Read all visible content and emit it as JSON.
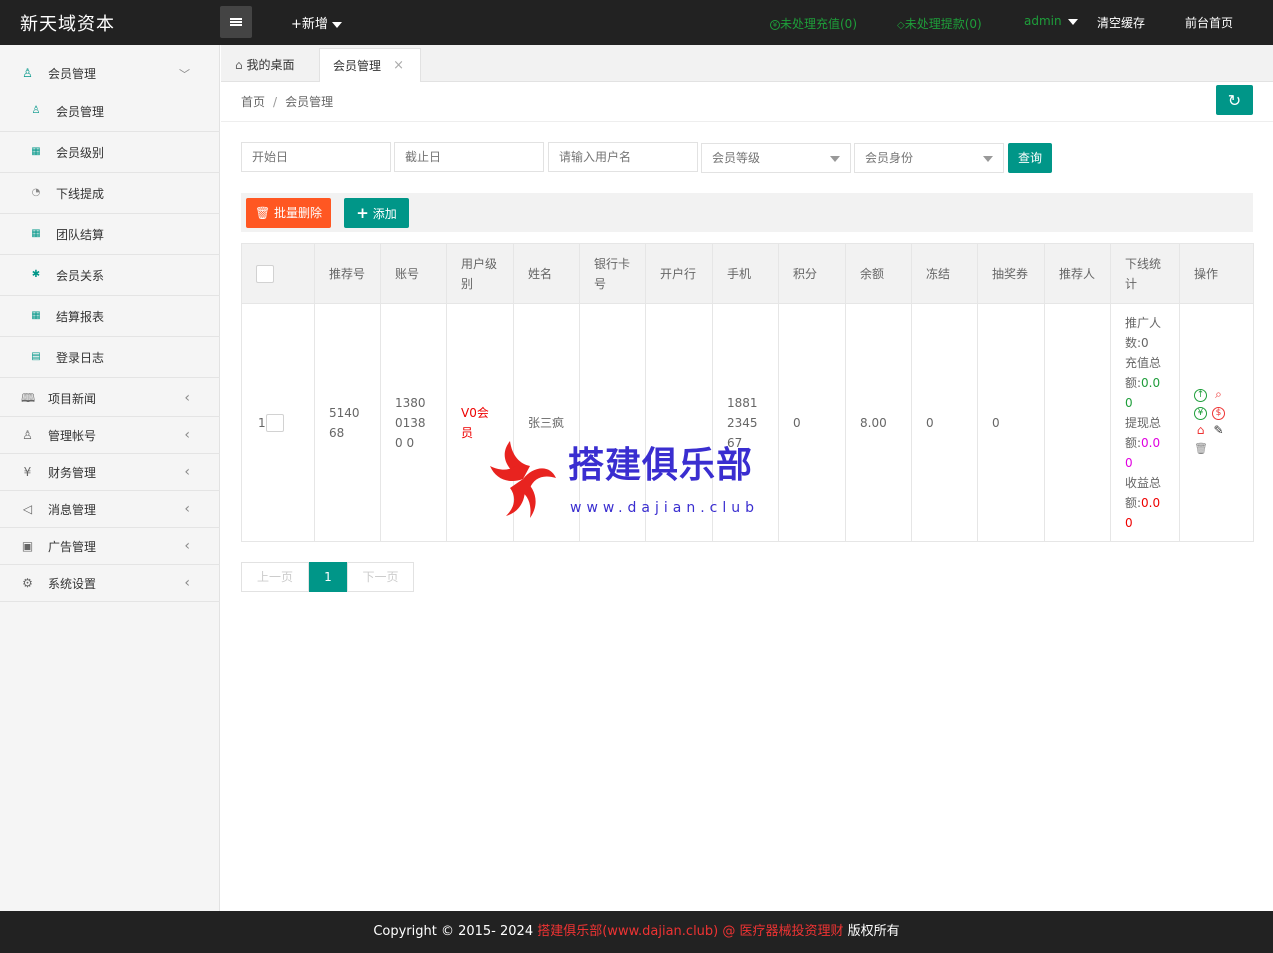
{
  "topbar": {
    "logo": "新天域资本",
    "add_new": "+新增",
    "pending_recharge": "未处理充值(0)",
    "pending_withdraw": "未处理提款(0)",
    "admin": "admin",
    "clear_cache": "清空缓存",
    "frontend_home": "前台首页"
  },
  "sidebar": {
    "member_group": "会员管理",
    "sub_items": [
      "会员管理",
      "会员级别",
      "下线提成",
      "团队结算",
      "会员关系",
      "结算报表",
      "登录日志"
    ],
    "groups": [
      "项目新闻",
      "管理帐号",
      "财务管理",
      "消息管理",
      "广告管理",
      "系统设置"
    ]
  },
  "tabs": {
    "desktop": "我的桌面",
    "members": "会员管理"
  },
  "breadcrumb": {
    "home": "首页",
    "sep": "/",
    "current": "会员管理"
  },
  "filters": {
    "start_date": "开始日",
    "end_date": "截止日",
    "username_placeholder": "请输入用户名",
    "level_select": "会员等级",
    "identity_select": "会员身份",
    "query": "查询"
  },
  "toolbar": {
    "batch_delete": "批量删除",
    "add": "添加"
  },
  "table": {
    "headers": [
      "推荐号",
      "账号",
      "用户级别",
      "姓名",
      "银行卡号",
      "开户行",
      "手机",
      "积分",
      "余额",
      "冻结",
      "抽奖券",
      "推荐人",
      "下线统计",
      "操作"
    ],
    "rows": [
      {
        "index": "1",
        "ref_no": "514068",
        "account": "138001380 0",
        "level": "V0会员",
        "name": "张三疯",
        "bank_card": "",
        "bank": "",
        "phone": "1881234567",
        "points": "0",
        "balance": "8.00",
        "frozen": "0",
        "lottery": "0",
        "referrer": "",
        "stats": {
          "promoted_label": "推广人数:",
          "promoted_value": "0",
          "recharge_label": "充值总额:",
          "recharge_value": "0.00",
          "withdraw_label": "提现总额:",
          "withdraw_value": "0.00",
          "income_label": "收益总额:",
          "income_value": "0.00"
        }
      }
    ]
  },
  "pager": {
    "prev": "上一页",
    "current": "1",
    "next": "下一页"
  },
  "watermark": {
    "text": "搭建俱乐部",
    "url": "www.dajian.club"
  },
  "footer": {
    "prefix": "Copyright © 2015- 2024",
    "highlight": "搭建俱乐部(www.dajian.club) @ 医疗器械投资理财",
    "suffix": "版权所有"
  },
  "colors": {
    "primary": "#009688",
    "danger": "#ff5722",
    "topbar": "#222222",
    "pending": "#1e9e3a"
  }
}
